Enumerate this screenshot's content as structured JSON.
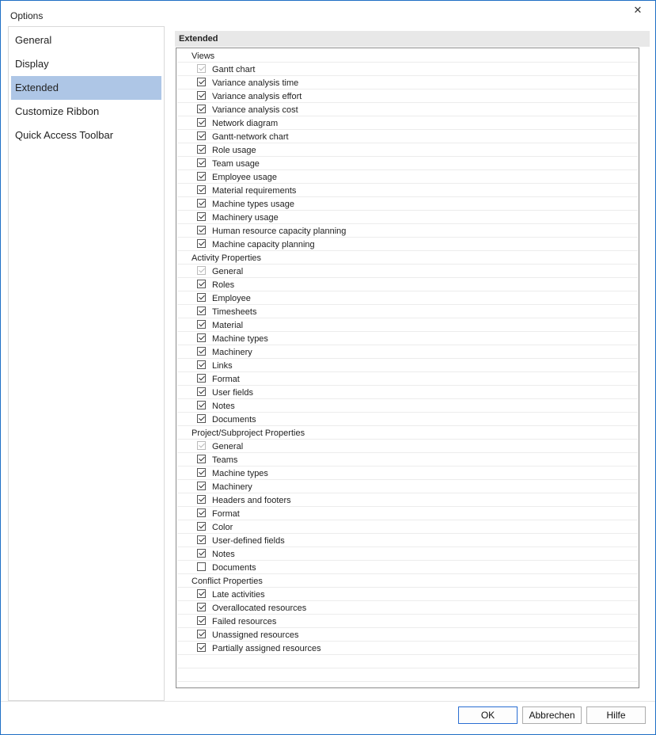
{
  "window": {
    "title": "Options",
    "close_glyph": "✕"
  },
  "nav": {
    "items": [
      {
        "label": "General",
        "selected": false
      },
      {
        "label": "Display",
        "selected": false
      },
      {
        "label": "Extended",
        "selected": true
      },
      {
        "label": "Customize Ribbon",
        "selected": false
      },
      {
        "label": "Quick Access Toolbar",
        "selected": false
      }
    ]
  },
  "panel": {
    "header": "Extended",
    "groups": [
      {
        "label": "Views",
        "items": [
          {
            "label": "Gantt chart",
            "checked": true,
            "disabled": true
          },
          {
            "label": "Variance analysis time",
            "checked": true,
            "disabled": false
          },
          {
            "label": "Variance analysis effort",
            "checked": true,
            "disabled": false
          },
          {
            "label": "Variance analysis cost",
            "checked": true,
            "disabled": false
          },
          {
            "label": "Network diagram",
            "checked": true,
            "disabled": false
          },
          {
            "label": "Gantt-network chart",
            "checked": true,
            "disabled": false
          },
          {
            "label": "Role usage",
            "checked": true,
            "disabled": false
          },
          {
            "label": "Team usage",
            "checked": true,
            "disabled": false
          },
          {
            "label": "Employee usage",
            "checked": true,
            "disabled": false
          },
          {
            "label": "Material requirements",
            "checked": true,
            "disabled": false
          },
          {
            "label": "Machine types usage",
            "checked": true,
            "disabled": false
          },
          {
            "label": "Machinery usage",
            "checked": true,
            "disabled": false
          },
          {
            "label": "Human resource capacity planning",
            "checked": true,
            "disabled": false
          },
          {
            "label": "Machine capacity planning",
            "checked": true,
            "disabled": false
          }
        ]
      },
      {
        "label": "Activity Properties",
        "items": [
          {
            "label": "General",
            "checked": true,
            "disabled": true
          },
          {
            "label": "Roles",
            "checked": true,
            "disabled": false
          },
          {
            "label": "Employee",
            "checked": true,
            "disabled": false
          },
          {
            "label": "Timesheets",
            "checked": true,
            "disabled": false
          },
          {
            "label": "Material",
            "checked": true,
            "disabled": false
          },
          {
            "label": "Machine types",
            "checked": true,
            "disabled": false
          },
          {
            "label": "Machinery",
            "checked": true,
            "disabled": false
          },
          {
            "label": "Links",
            "checked": true,
            "disabled": false
          },
          {
            "label": "Format",
            "checked": true,
            "disabled": false
          },
          {
            "label": "User fields",
            "checked": true,
            "disabled": false
          },
          {
            "label": "Notes",
            "checked": true,
            "disabled": false
          },
          {
            "label": "Documents",
            "checked": true,
            "disabled": false
          }
        ]
      },
      {
        "label": "Project/Subproject Properties",
        "items": [
          {
            "label": "General",
            "checked": true,
            "disabled": true
          },
          {
            "label": "Teams",
            "checked": true,
            "disabled": false
          },
          {
            "label": "Machine types",
            "checked": true,
            "disabled": false
          },
          {
            "label": "Machinery",
            "checked": true,
            "disabled": false
          },
          {
            "label": "Headers and footers",
            "checked": true,
            "disabled": false
          },
          {
            "label": "Format",
            "checked": true,
            "disabled": false
          },
          {
            "label": "Color",
            "checked": true,
            "disabled": false
          },
          {
            "label": "User-defined fields",
            "checked": true,
            "disabled": false
          },
          {
            "label": "Notes",
            "checked": true,
            "disabled": false
          },
          {
            "label": "Documents",
            "checked": false,
            "disabled": false
          }
        ]
      },
      {
        "label": "Conflict Properties",
        "items": [
          {
            "label": "Late activities",
            "checked": true,
            "disabled": false
          },
          {
            "label": "Overallocated resources",
            "checked": true,
            "disabled": false
          },
          {
            "label": "Failed resources",
            "checked": true,
            "disabled": false
          },
          {
            "label": "Unassigned resources",
            "checked": true,
            "disabled": false
          },
          {
            "label": "Partially assigned resources",
            "checked": true,
            "disabled": false
          }
        ]
      }
    ]
  },
  "buttons": {
    "ok": "OK",
    "cancel": "Abbrechen",
    "help": "Hilfe"
  }
}
